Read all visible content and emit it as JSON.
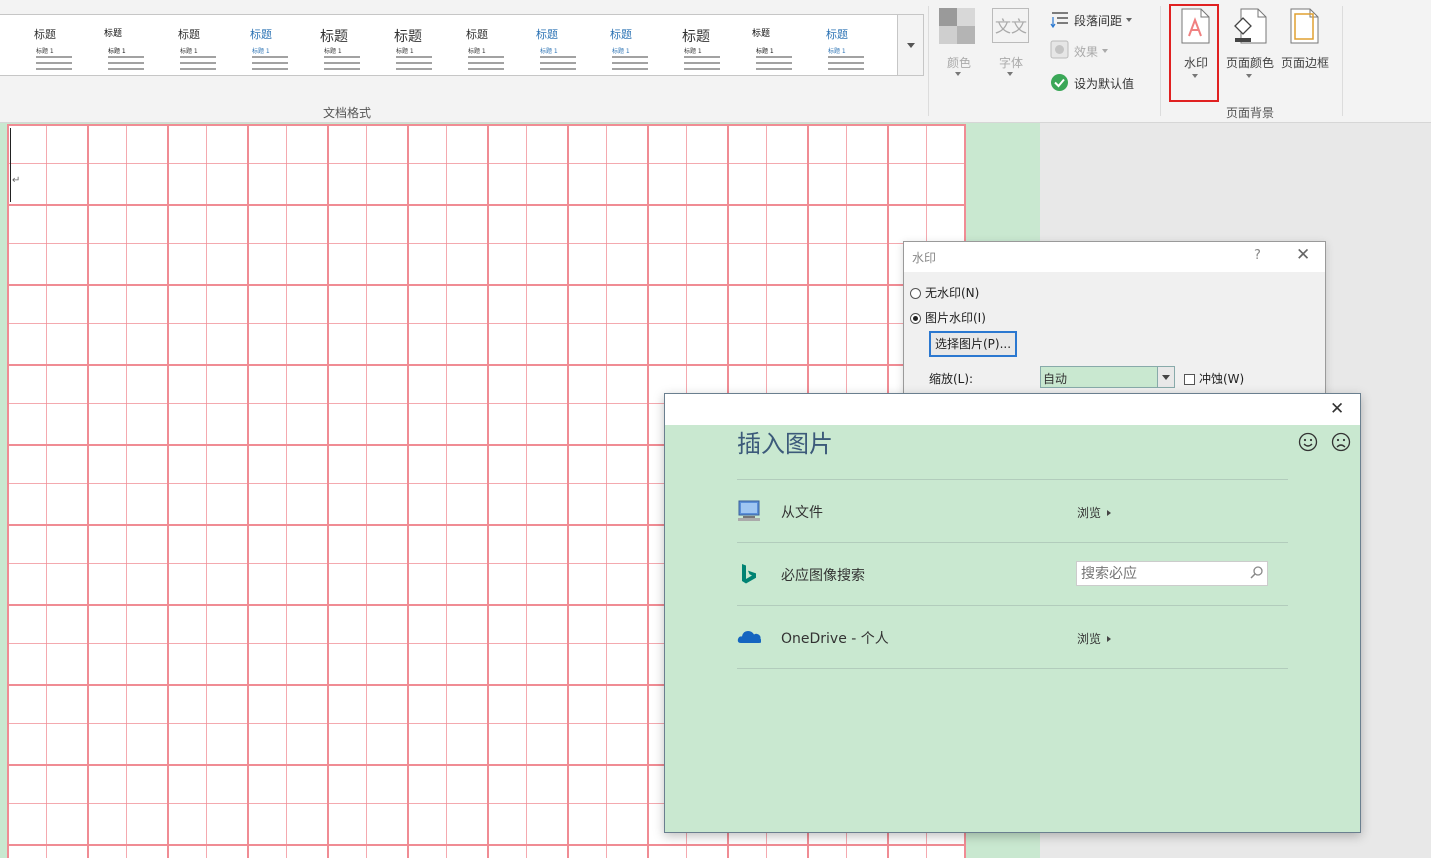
{
  "ribbon": {
    "style_gallery": [
      {
        "title": "标题",
        "h1": "标题 1",
        "accent": "#333333"
      },
      {
        "title": "标题",
        "h1": "标题 1",
        "accent": "#111111"
      },
      {
        "title": "标题",
        "h1": "标题 1",
        "accent": "#333333"
      },
      {
        "title": "标题",
        "h1": "标题 1",
        "accent": "#2e74b5"
      },
      {
        "title": "标题",
        "h1": "标题 1",
        "accent": "#333333"
      },
      {
        "title": "标题",
        "h1": "标题 1",
        "accent": "#333333"
      },
      {
        "title": "标题",
        "h1": "标题 1",
        "accent": "#333333"
      },
      {
        "title": "标题",
        "h1": "标题 1",
        "accent": "#2e74b5"
      },
      {
        "title": "标题",
        "h1": "标题 1",
        "accent": "#2e74b5"
      },
      {
        "title": "标题",
        "h1": "标题 1",
        "accent": "#333333"
      },
      {
        "title": "标题",
        "h1": "标题 1",
        "accent": "#111111"
      },
      {
        "title": "标题",
        "h1": "标题 1",
        "accent": "#2e74b5"
      }
    ],
    "doc_format_group_label": "文档格式",
    "colors_label": "颜色",
    "fonts_label": "字体",
    "paragraph_spacing_label": "段落间距",
    "effects_label": "效果",
    "set_default_label": "设为默认值",
    "watermark_label": "水印",
    "page_color_label": "页面颜色",
    "page_borders_label": "页面边框",
    "page_background_group_label": "页面背景"
  },
  "document": {
    "paragraph_mark": "↵"
  },
  "watermark_dialog": {
    "title": "水印",
    "help": "?",
    "close": "✕",
    "no_watermark": "无水印(N)",
    "picture_watermark": "图片水印(I)",
    "select_picture_button": "选择图片(P)...",
    "scale_label": "缩放(L):",
    "scale_value": "自动",
    "washout_label": "冲蚀(W)"
  },
  "insert_pictures_dialog": {
    "title": "插入图片",
    "close": "✕",
    "rows": [
      {
        "label": "从文件",
        "action": "浏览",
        "icon": "computer-icon"
      },
      {
        "label": "必应图像搜索",
        "search_placeholder": "搜索必应",
        "icon": "bing-icon"
      },
      {
        "label": "OneDrive - 个人",
        "action": "浏览",
        "icon": "onedrive-icon"
      }
    ]
  },
  "colors": {
    "highlight": "#e02020",
    "page_grid": "#f08c94",
    "dialog_bg": "#c9e8d0",
    "title_blue": "#3c5a7a"
  }
}
